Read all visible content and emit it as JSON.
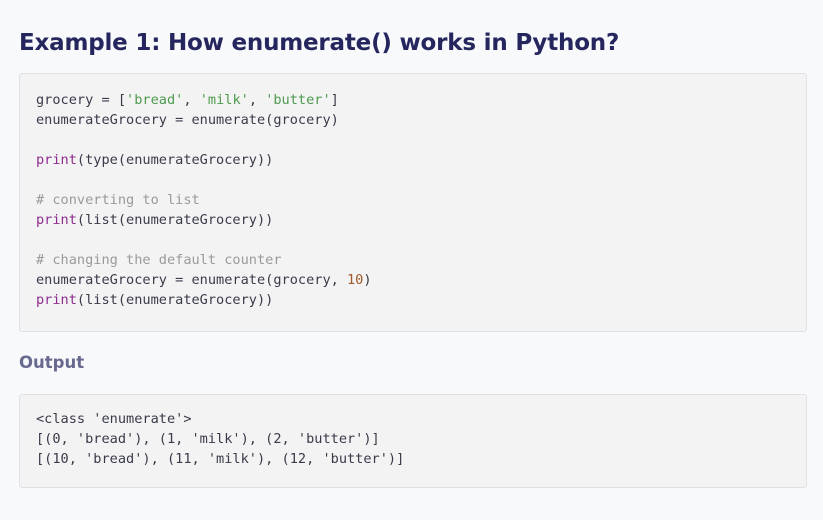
{
  "heading": "Example 1: How enumerate() works in Python?",
  "code": {
    "line1": {
      "a": "grocery = [",
      "s1": "'bread'",
      "sep1": ", ",
      "s2": "'milk'",
      "sep2": ", ",
      "s3": "'butter'",
      "end": "]"
    },
    "line2": "enumerateGrocery = enumerate(grocery)",
    "line3": {
      "fn": "print",
      "rest": "(type(enumerateGrocery))"
    },
    "comment1": "# converting to list",
    "line4": {
      "fn": "print",
      "rest": "(list(enumerateGrocery))"
    },
    "comment2": "# changing the default counter",
    "line5": {
      "a": "enumerateGrocery = enumerate(grocery, ",
      "num": "10",
      "end": ")"
    },
    "line6": {
      "fn": "print",
      "rest": "(list(enumerateGrocery))"
    }
  },
  "output_heading": "Output",
  "output_lines": [
    "<class 'enumerate'>",
    "[(0, 'bread'), (1, 'milk'), (2, 'butter')]",
    "[(10, 'bread'), (11, 'milk'), (12, 'butter')]"
  ],
  "colors": {
    "heading": "#25265e",
    "output_heading": "#68698f",
    "string": "#4e9a4f",
    "function": "#8e2c8e",
    "comment": "#9a9a9a",
    "number": "#a0592b",
    "code_background": "#f3f3f3"
  }
}
